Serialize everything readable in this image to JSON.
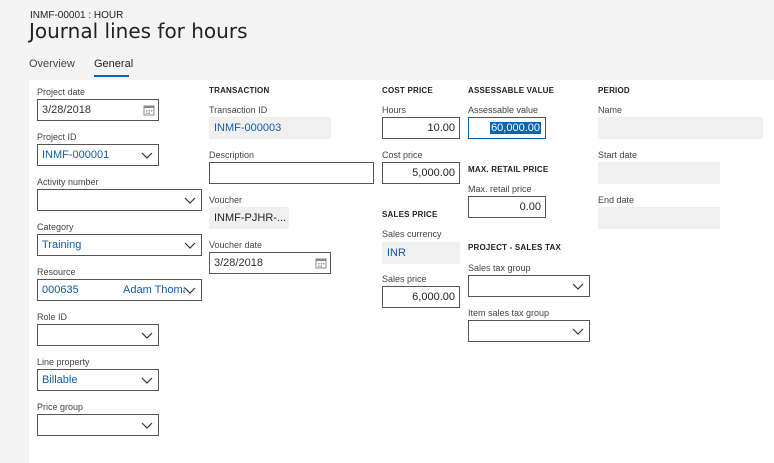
{
  "page": {
    "breadcrumb": "INMF-00001 : HOUR",
    "title": "Journal lines for hours",
    "tabs": [
      "Overview",
      "General"
    ],
    "active_tab": "General"
  },
  "left": {
    "project_date_label": "Project date",
    "project_date": "3/28/2018",
    "project_id_label": "Project ID",
    "project_id": "INMF-000001",
    "activity_label": "Activity number",
    "activity": "",
    "category_label": "Category",
    "category": "Training",
    "resource_label": "Resource",
    "resource_id": "000635",
    "resource_name": "Adam Thoma",
    "role_label": "Role ID",
    "role": "",
    "line_property_label": "Line property",
    "line_property": "Billable",
    "price_group_label": "Price group",
    "price_group": ""
  },
  "transaction": {
    "heading": "TRANSACTION",
    "transaction_id_label": "Transaction ID",
    "transaction_id": "INMF-000003",
    "description_label": "Description",
    "description": "",
    "voucher_label": "Voucher",
    "voucher": "INMF-PJHR-...",
    "voucher_date_label": "Voucher date",
    "voucher_date": "3/28/2018"
  },
  "cost": {
    "heading": "COST PRICE",
    "hours_label": "Hours",
    "hours": "10.00",
    "cost_price_label": "Cost price",
    "cost_price": "5,000.00"
  },
  "sales": {
    "heading": "SALES PRICE",
    "currency_label": "Sales currency",
    "currency": "INR",
    "sales_price_label": "Sales price",
    "sales_price": "6,000.00"
  },
  "assessable": {
    "heading": "ASSESSABLE VALUE",
    "value_label": "Assessable value",
    "value": "60,000.00"
  },
  "mrp": {
    "heading": "MAX. RETAIL PRICE",
    "label": "Max. retail price",
    "value": "0.00"
  },
  "tax": {
    "heading": "PROJECT - SALES TAX",
    "group_label": "Sales tax group",
    "group": "",
    "item_group_label": "Item sales tax group",
    "item_group": ""
  },
  "period": {
    "heading": "PERIOD",
    "name_label": "Name",
    "name": "",
    "start_label": "Start date",
    "start": "",
    "end_label": "End date",
    "end": ""
  },
  "icons": {
    "calendar": "calendar-icon",
    "dropdown": "chevron-down-icon"
  }
}
